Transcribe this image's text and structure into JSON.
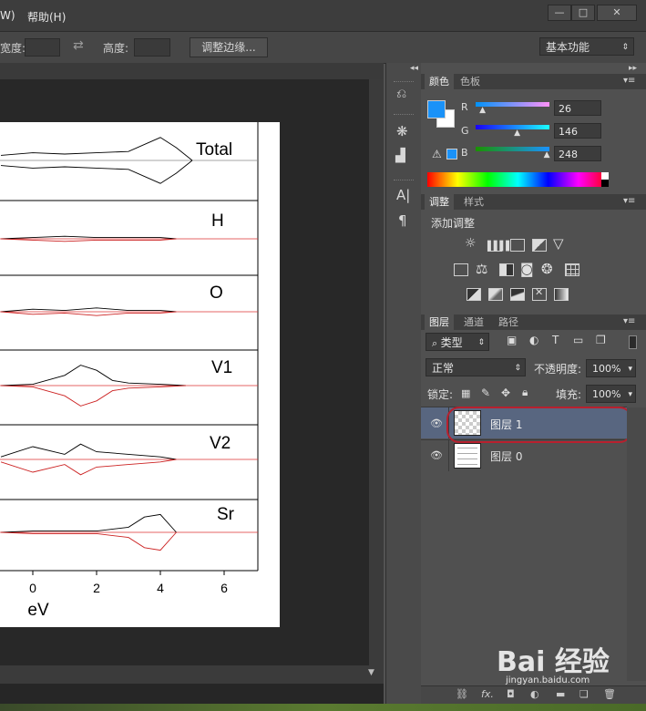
{
  "menubar": {
    "items": [
      "W)",
      "帮助(H)"
    ],
    "window_controls": [
      "—",
      "□",
      "✕"
    ]
  },
  "options": {
    "width_label": "宽度:",
    "height_label": "高度:",
    "refine_edge": "调整边缘...",
    "workspace": "基本功能"
  },
  "chart_data": {
    "type": "line",
    "title": "",
    "panels": [
      "Total",
      "H",
      "O",
      "V1",
      "V2",
      "Sr"
    ],
    "x_ticks": [
      "0",
      "2",
      "4",
      "6"
    ],
    "xlabel": "eV",
    "series": [
      {
        "name": "Total",
        "color": "#000000",
        "x": [
          -1,
          0,
          1,
          2,
          3,
          4,
          4.5,
          5
        ],
        "y": [
          0.2,
          0.3,
          0.25,
          0.3,
          0.35,
          0.9,
          0.5,
          0
        ]
      },
      {
        "name": "H",
        "color": "#000000",
        "x": [
          -1,
          0,
          1,
          2,
          3,
          4,
          4.5
        ],
        "y": [
          0,
          0.05,
          0.1,
          0.05,
          0.05,
          0.05,
          0
        ]
      },
      {
        "name": "O",
        "color": "#000000",
        "x": [
          -1,
          0,
          1,
          2,
          3,
          4,
          4.5
        ],
        "y": [
          0,
          0.1,
          0.05,
          0.15,
          0.05,
          0.05,
          0
        ]
      },
      {
        "name": "V1",
        "color": "#000000",
        "x": [
          -1,
          0,
          1,
          1.5,
          2,
          2.5,
          3,
          4,
          4.8
        ],
        "y": [
          0,
          0.05,
          0.4,
          0.8,
          0.6,
          0.2,
          0.1,
          0.05,
          0
        ]
      },
      {
        "name": "V2",
        "color": "#000000",
        "x": [
          -1,
          0,
          1,
          1.5,
          2,
          3,
          4,
          4.5
        ],
        "y": [
          0.1,
          0.5,
          0.2,
          0.6,
          0.3,
          0.2,
          0.1,
          0
        ]
      },
      {
        "name": "Sr",
        "color": "#000000",
        "x": [
          -1,
          0,
          2,
          3,
          3.5,
          4,
          4.5
        ],
        "y": [
          0,
          0.05,
          0.05,
          0.2,
          0.6,
          0.7,
          0
        ]
      }
    ]
  },
  "color_panel": {
    "tabs": [
      "颜色",
      "色板"
    ],
    "r_label": "R",
    "g_label": "G",
    "b_label": "B",
    "r": "26",
    "g": "146",
    "b": "248",
    "fg_color": "#1a92f8",
    "bg_color": "#ffffff",
    "r_fraction": 0.1,
    "g_fraction": 0.57,
    "b_fraction": 0.97
  },
  "adjust_panel": {
    "tabs": [
      "调整",
      "样式"
    ],
    "heading": "添加调整",
    "rows": [
      [
        "brightness-icon",
        "levels-icon",
        "curves-icon",
        "exposure-icon",
        "vibrance-icon"
      ],
      [
        "hue-saturation-icon",
        "color-balance-icon",
        "black-white-icon",
        "photo-filter-icon",
        "channel-mixer-icon",
        "color-lookup-icon"
      ],
      [
        "invert-icon",
        "posterize-icon",
        "threshold-icon",
        "selective-color-icon",
        "gradient-map-icon"
      ]
    ]
  },
  "layers_panel": {
    "tabs": [
      "图层",
      "通道",
      "路径"
    ],
    "filter_label": "类型",
    "blend_mode": "正常",
    "opacity_label": "不透明度:",
    "opacity": "100%",
    "lock_label": "锁定:",
    "fill_label": "填充:",
    "fill": "100%",
    "layers": [
      {
        "name": "图层 1",
        "selected": true
      },
      {
        "name": "图层 0",
        "selected": false
      }
    ],
    "footer_icons": [
      "link-icon",
      "fx-icon",
      "mask-icon",
      "adjustment-icon",
      "group-icon",
      "new-layer-icon",
      "trash-icon"
    ]
  },
  "watermark": {
    "text": "Bai 经验",
    "url": "jingyan.baidu.com"
  }
}
